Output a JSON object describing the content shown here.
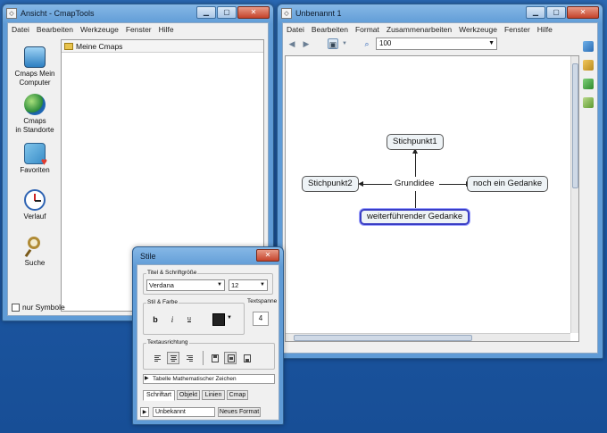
{
  "left_window": {
    "title": "Ansicht - CmapTools",
    "menu": [
      "Datei",
      "Bearbeiten",
      "Werkzeuge",
      "Fenster",
      "Hilfe"
    ],
    "sidebar": [
      {
        "label_line1": "Cmaps Mein",
        "label_line2": "Computer",
        "icon": "computer-icon"
      },
      {
        "label_line1": "Cmaps",
        "label_line2": "in Standorte",
        "icon": "globe-icon"
      },
      {
        "label_line1": "Favoriten",
        "label_line2": "",
        "icon": "favorites-icon"
      },
      {
        "label_line1": "Verlauf",
        "label_line2": "",
        "icon": "history-icon"
      },
      {
        "label_line1": "Suche",
        "label_line2": "",
        "icon": "search-icon"
      }
    ],
    "panel_header": "Meine Cmaps",
    "checkbox_label": "nur Symbole"
  },
  "right_window": {
    "title": "Unbenannt 1",
    "menu": [
      "Datei",
      "Bearbeiten",
      "Format",
      "Zusammenarbeiten",
      "Werkzeuge",
      "Fenster",
      "Hilfe"
    ],
    "zoom_value": "100",
    "nodes": {
      "stichpunkt1": "Stichpunkt1",
      "stichpunkt2": "Stichpunkt2",
      "grundidee": "Grundidee",
      "gedanke": "noch ein Gedanke",
      "weiter": "weiterführender Gedanke"
    }
  },
  "stile": {
    "title": "Stile",
    "group_font": "Titel & Schriftgröße",
    "font_name": "Verdana",
    "font_size": "12",
    "group_style": "Stil & Farbe",
    "bold": "b",
    "italic": "i",
    "underline": "u",
    "group_spacing": "Textspanne",
    "spacing_value": "4",
    "group_align": "Textausrichtung",
    "math_label": "Tabelle Mathematischer Zeichen",
    "tabs": [
      "Schriftart",
      "Objekt",
      "Linien",
      "Cmap"
    ],
    "style_name": "Unbekannt",
    "new_format": "Neues Format"
  },
  "colors": {
    "desktop": "#1e5aa6",
    "selection_border": "#3a3ec4",
    "node_fill": "#eef3f6"
  }
}
